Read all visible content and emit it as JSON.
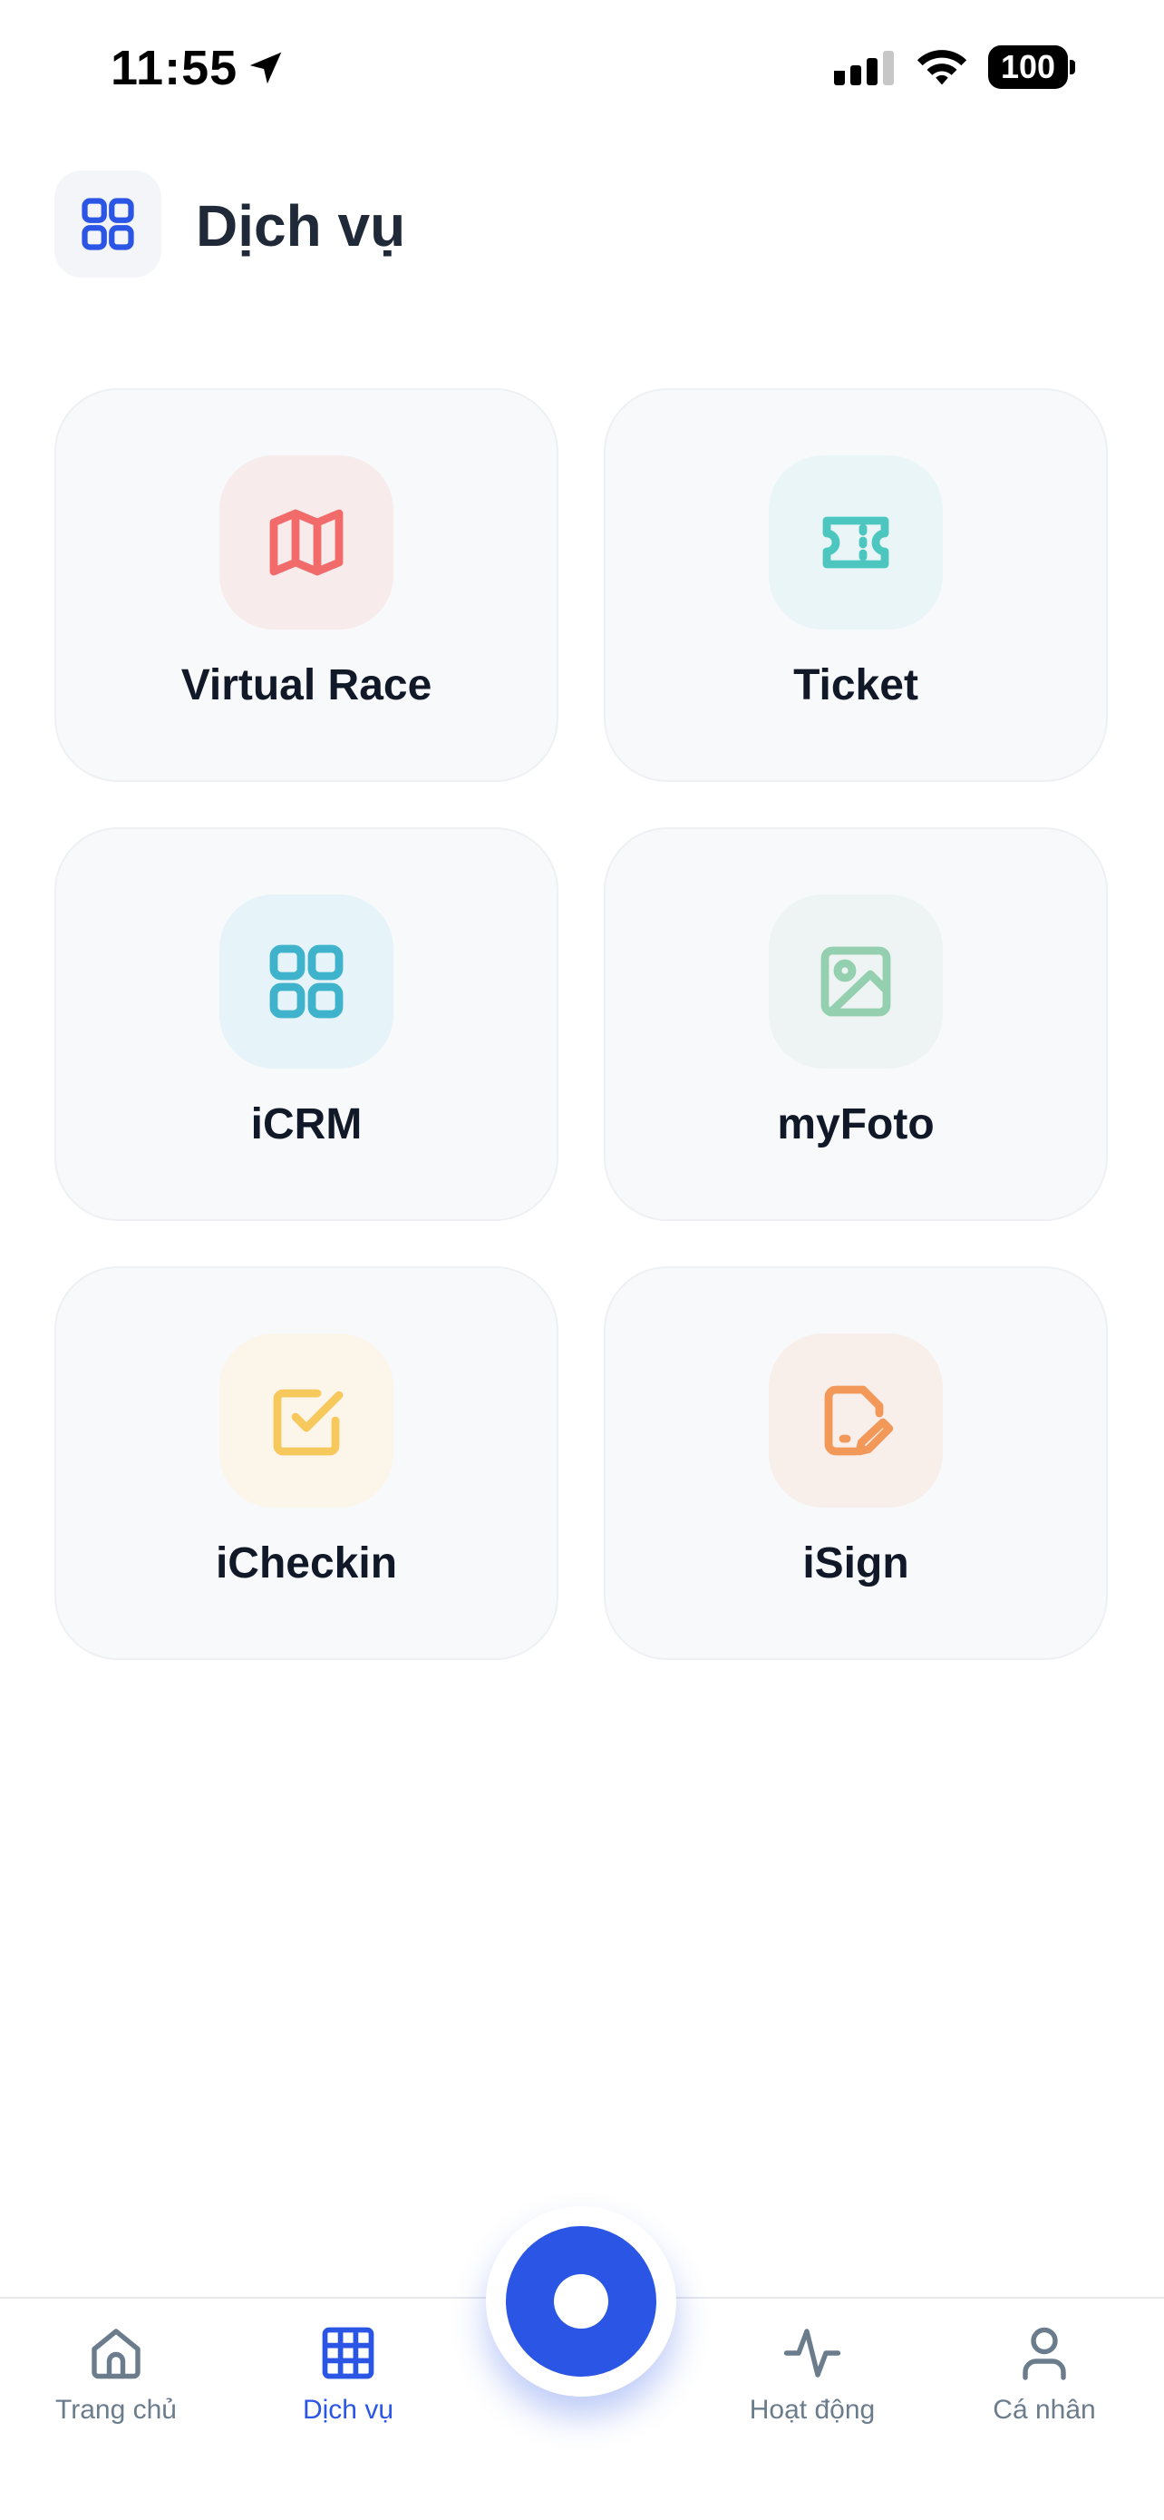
{
  "status_bar": {
    "time": "11:55",
    "battery": "100",
    "icons": [
      "location-arrow-icon",
      "signal-icon",
      "wifi-icon",
      "battery-icon"
    ]
  },
  "header": {
    "title": "Dịch vụ",
    "icon": "grid-icon",
    "accent_color": "#2A55E5"
  },
  "services": [
    {
      "label": "Virtual Race",
      "icon": "map-icon",
      "color": "#F26B6B",
      "bg": "#F7EBEC"
    },
    {
      "label": "Ticket",
      "icon": "ticket-icon",
      "color": "#4CC6BE",
      "bg": "#E9F5F6"
    },
    {
      "label": "iCRM",
      "icon": "grid-icon",
      "color": "#3FB3CC",
      "bg": "#E6F3F8"
    },
    {
      "label": "myFoto",
      "icon": "image-icon",
      "color": "#94CFB0",
      "bg": "#EEF4F3"
    },
    {
      "label": "iCheckin",
      "icon": "checkbox-icon",
      "color": "#F7C95C",
      "bg": "#FBF5EA"
    },
    {
      "label": "iSign",
      "icon": "file-signature-icon",
      "color": "#F2995A",
      "bg": "#F8EFEA"
    }
  ],
  "bottom_nav": {
    "items": [
      {
        "label": "Trang chủ",
        "icon": "home-icon",
        "active": false
      },
      {
        "label": "Dịch vụ",
        "icon": "grid-icon",
        "active": true
      },
      {
        "label": "Hoạt động",
        "icon": "activity-icon",
        "active": false
      },
      {
        "label": "Cá nhân",
        "icon": "user-icon",
        "active": false
      }
    ],
    "active_color": "#2A55E5",
    "inactive_color": "#6B7C8C",
    "center_button_icon": "record-icon"
  }
}
